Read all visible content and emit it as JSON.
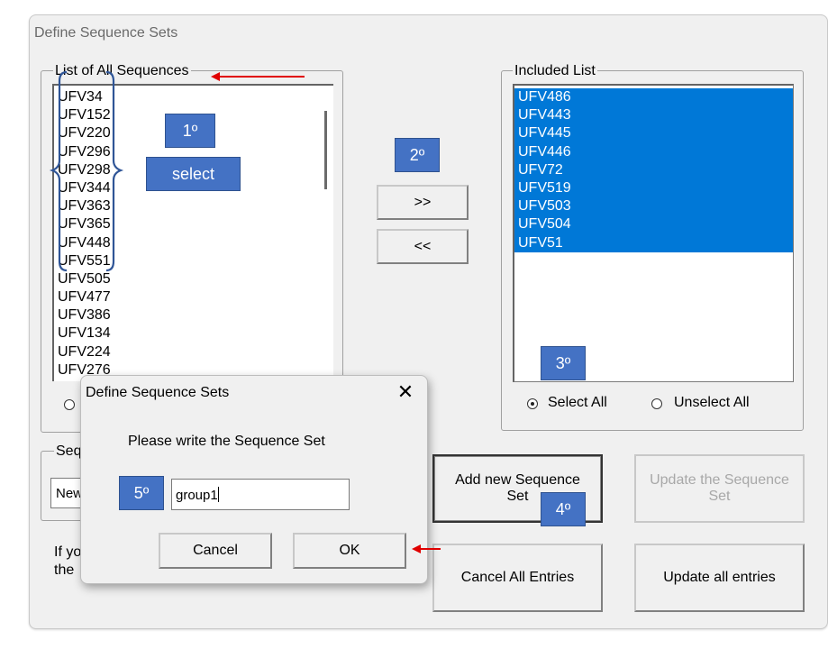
{
  "window": {
    "title": "Define Sequence Sets"
  },
  "all_sequences": {
    "legend": "List of All Sequences",
    "items": [
      "UFV34",
      "UFV152",
      "UFV220",
      "UFV296",
      "UFV298",
      "UFV344",
      "UFV363",
      "UFV365",
      "UFV448",
      "UFV551",
      "UFV505",
      "UFV477",
      "UFV386",
      "UFV134",
      "UFV224",
      "UFV276"
    ]
  },
  "included": {
    "legend": "Included List",
    "items": [
      "UFV486",
      "UFV443",
      "UFV445",
      "UFV446",
      "UFV72",
      "UFV519",
      "UFV503",
      "UFV504",
      "UFV51"
    ],
    "select_all_label": "Select All",
    "unselect_all_label": "Unselect All"
  },
  "buttons": {
    "add_label": ">>",
    "remove_label": "<<",
    "add_new_set_label": "Add new Sequence Set",
    "update_set_label": "Update the Sequence Set",
    "cancel_all_label": "Cancel All Entries",
    "update_all_label": "Update all entries"
  },
  "obscured": {
    "seq_legend": "Seq",
    "seq_value": "New",
    "note_line1": "If yo",
    "note_line2": "the"
  },
  "annotations": {
    "step1": "1º",
    "select": "select",
    "step2": "2º",
    "step3": "3º",
    "step4": "4º",
    "step5": "5º"
  },
  "dialog": {
    "title": "Define Sequence Sets",
    "prompt": "Please write the Sequence Set",
    "input_value": "group1",
    "cancel_label": "Cancel",
    "ok_label": "OK"
  },
  "colors": {
    "selection": "#0078d7",
    "annotation_box": "#4472c4",
    "arrow": "#e00000",
    "bracket": "#2f5597"
  }
}
